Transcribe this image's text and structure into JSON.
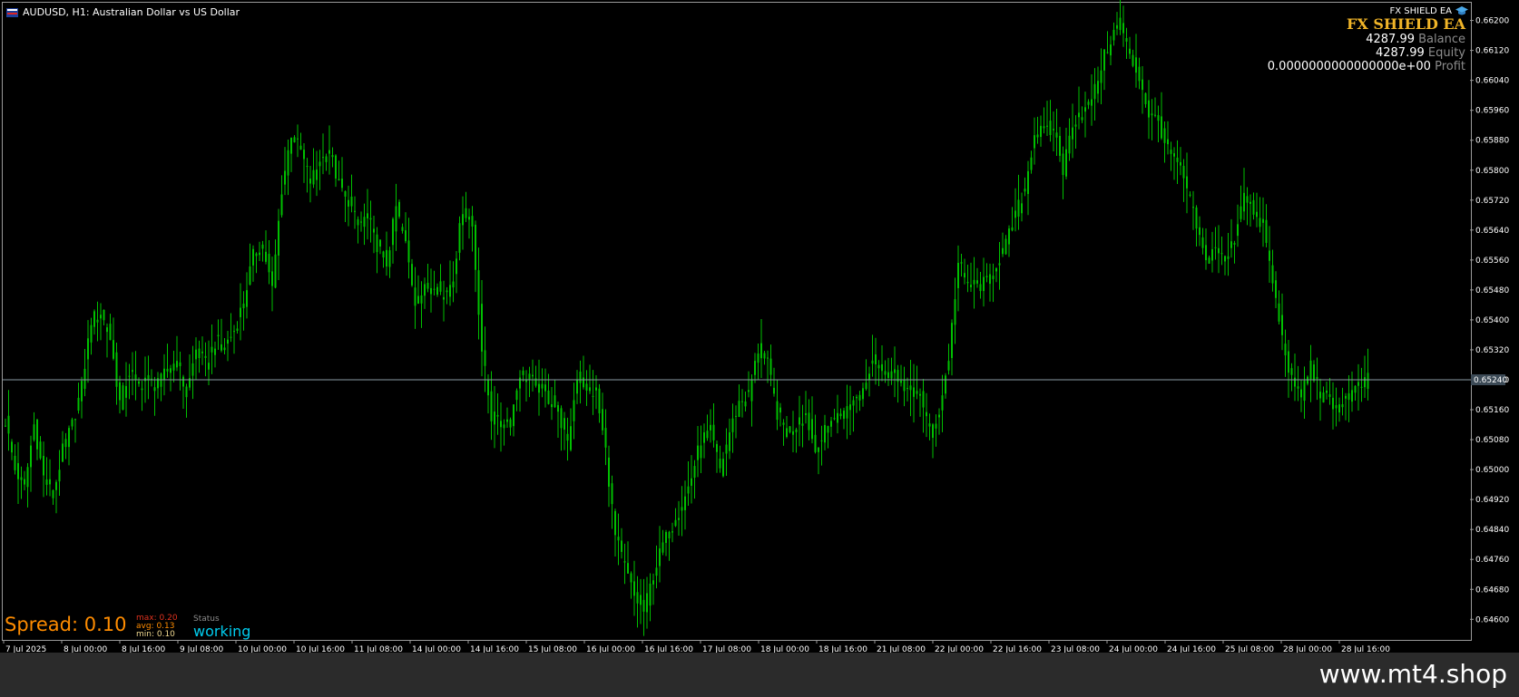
{
  "window": {
    "title": "AUDUSD, H1:  Australian Dollar vs US Dollar"
  },
  "ea": {
    "tag": "FX SHIELD EA",
    "title": "FX SHIELD EA",
    "balance": "4287.99",
    "balance_label": "Balance",
    "equity": "4287.99",
    "equity_label": "Equity",
    "profit": "0.0000000000000000e+00",
    "profit_label": "Profit"
  },
  "spread": {
    "text": "Spread: 0.10",
    "max": "max:  0.20",
    "avg": "avg:  0.13",
    "min": "min:  0.10"
  },
  "status": {
    "label": "Status",
    "value": "working"
  },
  "footer": {
    "text": "www.mt4.shop"
  },
  "colors": {
    "background": "#000000",
    "candles": "#00c000",
    "bid_line": "#8c9ba6",
    "axis_text": "#ffffff",
    "price_tag_bg": "#3c4a56"
  },
  "chart_data": {
    "type": "candlestick",
    "symbol": "AUDUSD",
    "timeframe": "H1",
    "current_price": "0.65240",
    "ylim": [
      0.64545,
      0.66245
    ],
    "y_ticks": [
      "0.66200",
      "0.66120",
      "0.66040",
      "0.65960",
      "0.65880",
      "0.65800",
      "0.65720",
      "0.65640",
      "0.65560",
      "0.65480",
      "0.65400",
      "0.65320",
      "0.65240",
      "0.65160",
      "0.65080",
      "0.65000",
      "0.64920",
      "0.64840",
      "0.64760",
      "0.64680",
      "0.64600"
    ],
    "x_ticks": [
      "7 Jul 2025",
      "8 Jul 00:00",
      "8 Jul 16:00",
      "9 Jul 08:00",
      "10 Jul 00:00",
      "10 Jul 16:00",
      "11 Jul 08:00",
      "14 Jul 00:00",
      "14 Jul 16:00",
      "15 Jul 08:00",
      "16 Jul 00:00",
      "16 Jul 16:00",
      "17 Jul 08:00",
      "18 Jul 00:00",
      "18 Jul 16:00",
      "21 Jul 08:00",
      "22 Jul 00:00",
      "22 Jul 16:00",
      "23 Jul 08:00",
      "24 Jul 00:00",
      "24 Jul 16:00",
      "25 Jul 08:00",
      "28 Jul 00:00",
      "28 Jul 16:00"
    ],
    "close_path": [
      [
        0,
        0.6513
      ],
      [
        3,
        0.65
      ],
      [
        6,
        0.6495
      ],
      [
        9,
        0.6512
      ],
      [
        12,
        0.6498
      ],
      [
        15,
        0.6493
      ],
      [
        18,
        0.6505
      ],
      [
        21,
        0.6512
      ],
      [
        24,
        0.6522
      ],
      [
        27,
        0.654
      ],
      [
        30,
        0.6542
      ],
      [
        33,
        0.6535
      ],
      [
        36,
        0.6518
      ],
      [
        39,
        0.6526
      ],
      [
        42,
        0.6523
      ],
      [
        45,
        0.6524
      ],
      [
        48,
        0.6522
      ],
      [
        51,
        0.6527
      ],
      [
        54,
        0.6529
      ],
      [
        57,
        0.652
      ],
      [
        60,
        0.6532
      ],
      [
        63,
        0.6528
      ],
      [
        66,
        0.6534
      ],
      [
        69,
        0.6533
      ],
      [
        72,
        0.6537
      ],
      [
        75,
        0.6545
      ],
      [
        78,
        0.6557
      ],
      [
        81,
        0.656
      ],
      [
        84,
        0.6548
      ],
      [
        87,
        0.6575
      ],
      [
        90,
        0.659
      ],
      [
        93,
        0.6585
      ],
      [
        96,
        0.6577
      ],
      [
        99,
        0.6582
      ],
      [
        102,
        0.6585
      ],
      [
        105,
        0.6576
      ],
      [
        108,
        0.6572
      ],
      [
        111,
        0.6565
      ],
      [
        114,
        0.6568
      ],
      [
        117,
        0.656
      ],
      [
        120,
        0.6555
      ],
      [
        123,
        0.657
      ],
      [
        126,
        0.656
      ],
      [
        129,
        0.6545
      ],
      [
        132,
        0.6548
      ],
      [
        135,
        0.655
      ],
      [
        138,
        0.6546
      ],
      [
        141,
        0.6552
      ],
      [
        144,
        0.657
      ],
      [
        147,
        0.6565
      ],
      [
        150,
        0.6532
      ],
      [
        153,
        0.6514
      ],
      [
        156,
        0.6512
      ],
      [
        159,
        0.6513
      ],
      [
        162,
        0.6526
      ],
      [
        165,
        0.6524
      ],
      [
        168,
        0.6522
      ],
      [
        171,
        0.6519
      ],
      [
        174,
        0.6516
      ],
      [
        177,
        0.6506
      ],
      [
        180,
        0.6525
      ],
      [
        183,
        0.6522
      ],
      [
        186,
        0.652
      ],
      [
        189,
        0.6505
      ],
      [
        192,
        0.6482
      ],
      [
        195,
        0.6474
      ],
      [
        198,
        0.6466
      ],
      [
        201,
        0.6462
      ],
      [
        204,
        0.6472
      ],
      [
        207,
        0.648
      ],
      [
        210,
        0.6485
      ],
      [
        213,
        0.649
      ],
      [
        216,
        0.6498
      ],
      [
        219,
        0.6508
      ],
      [
        222,
        0.651
      ],
      [
        225,
        0.65
      ],
      [
        228,
        0.651
      ],
      [
        231,
        0.6518
      ],
      [
        234,
        0.652
      ],
      [
        237,
        0.6532
      ],
      [
        240,
        0.6528
      ],
      [
        243,
        0.6515
      ],
      [
        246,
        0.651
      ],
      [
        249,
        0.6512
      ],
      [
        252,
        0.6515
      ],
      [
        255,
        0.6505
      ],
      [
        258,
        0.651
      ],
      [
        261,
        0.6514
      ],
      [
        264,
        0.6515
      ],
      [
        267,
        0.6518
      ],
      [
        270,
        0.6522
      ],
      [
        273,
        0.653
      ],
      [
        276,
        0.6527
      ],
      [
        279,
        0.6526
      ],
      [
        282,
        0.6524
      ],
      [
        285,
        0.652
      ],
      [
        288,
        0.6521
      ],
      [
        291,
        0.651
      ],
      [
        294,
        0.6515
      ],
      [
        297,
        0.653
      ],
      [
        300,
        0.6555
      ],
      [
        303,
        0.655
      ],
      [
        306,
        0.6549
      ],
      [
        309,
        0.655
      ],
      [
        312,
        0.6555
      ],
      [
        315,
        0.656
      ],
      [
        318,
        0.6568
      ],
      [
        321,
        0.6575
      ],
      [
        324,
        0.659
      ],
      [
        327,
        0.659
      ],
      [
        330,
        0.6592
      ],
      [
        333,
        0.658
      ],
      [
        336,
        0.6593
      ],
      [
        339,
        0.6595
      ],
      [
        342,
        0.6598
      ],
      [
        345,
        0.6608
      ],
      [
        348,
        0.6615
      ],
      [
        351,
        0.662
      ],
      [
        354,
        0.661
      ],
      [
        357,
        0.6605
      ],
      [
        360,
        0.6595
      ],
      [
        363,
        0.6593
      ],
      [
        366,
        0.6585
      ],
      [
        369,
        0.6582
      ],
      [
        372,
        0.6575
      ],
      [
        375,
        0.6565
      ],
      [
        378,
        0.6555
      ],
      [
        381,
        0.656
      ],
      [
        384,
        0.6555
      ],
      [
        387,
        0.6562
      ],
      [
        390,
        0.6575
      ],
      [
        393,
        0.6568
      ],
      [
        396,
        0.6565
      ],
      [
        399,
        0.655
      ],
      [
        402,
        0.6535
      ],
      [
        405,
        0.6524
      ],
      [
        408,
        0.652
      ],
      [
        411,
        0.6528
      ],
      [
        414,
        0.652
      ],
      [
        417,
        0.6518
      ],
      [
        420,
        0.6517
      ],
      [
        423,
        0.652
      ],
      [
        426,
        0.6522
      ],
      [
        429,
        0.6524
      ]
    ]
  }
}
